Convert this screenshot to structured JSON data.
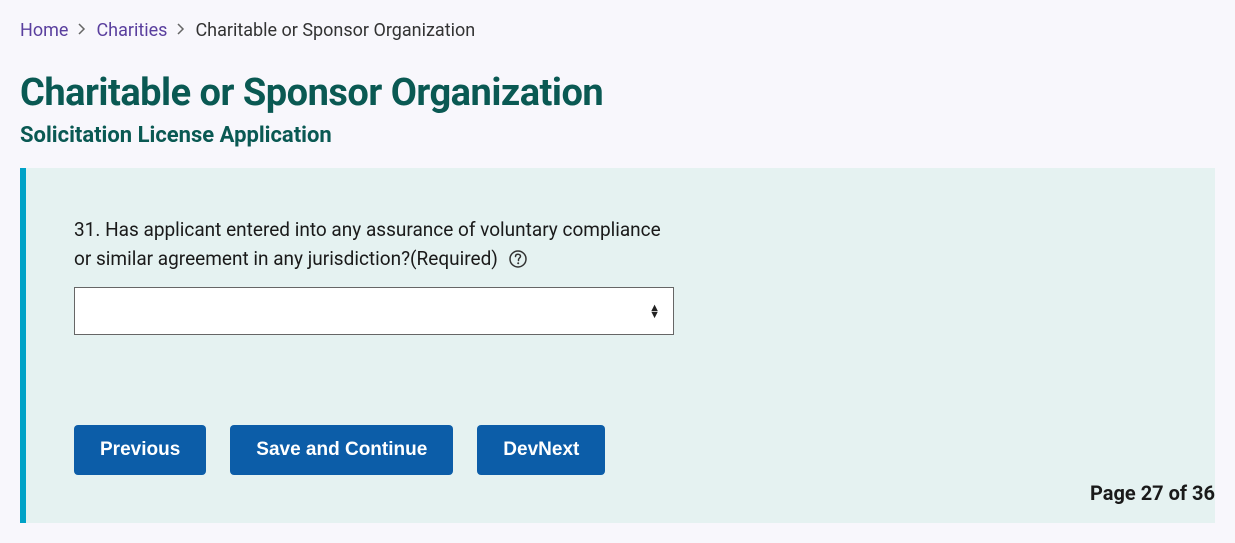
{
  "breadcrumb": {
    "home": "Home",
    "charities": "Charities",
    "current": "Charitable or Sponsor Organization"
  },
  "page": {
    "title": "Charitable or Sponsor Organization",
    "subtitle": "Solicitation License Application"
  },
  "form": {
    "question": "31. Has applicant entered into any assurance of voluntary compliance or similar agreement in any jurisdiction?",
    "required_suffix": "(Required)",
    "select_value": ""
  },
  "buttons": {
    "previous": "Previous",
    "save_continue": "Save and Continue",
    "dev_next": "DevNext"
  },
  "pagination": {
    "text": "Page 27 of 36"
  }
}
